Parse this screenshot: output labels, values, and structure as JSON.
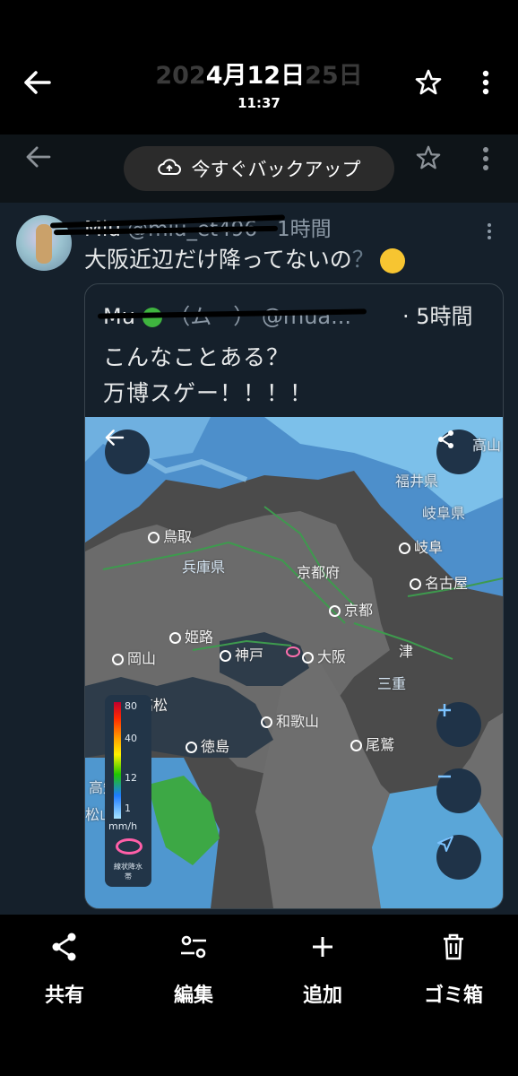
{
  "header": {
    "date_ghost_left": "202",
    "date": "4月12日",
    "date_ghost_right": "25日",
    "time": "11:37"
  },
  "backup": {
    "label": "今すぐバックアップ"
  },
  "tweet": {
    "name": "Miu",
    "handle": "@miu_et496",
    "time": "· 1時間",
    "text": "大阪近辺だけ降ってないの",
    "question_mark": "？"
  },
  "quote": {
    "name": "Mu",
    "handle": "@mua...",
    "time": "· 5時間",
    "line1": "こんなことある？",
    "line2": "万博スゲー！！！！"
  },
  "map": {
    "labels": {
      "tottori": "鳥取",
      "hyogo": "兵庫県",
      "kyoto_pref": "京都府",
      "kyoto": "京都",
      "fukui": "福井県",
      "gifu_pref": "岐阜県",
      "gifu": "岐阜",
      "nagoya": "名古屋",
      "okayama": "岡山",
      "himeji": "姫路",
      "kobe": "神戸",
      "osaka": "大阪",
      "tsu": "津",
      "takamatsu": "高松",
      "tokushima": "徳島",
      "wakayama": "和歌山",
      "owase": "尾鷲",
      "takayama": "高山",
      "kochi": "高知",
      "matsuyama": "松山",
      "mie": "三重",
      "unit": "mm/h",
      "ring_label": "線状降水帯"
    },
    "legend_values": [
      "80",
      "40",
      "12",
      "1"
    ]
  },
  "actions": {
    "share": "共有",
    "edit": "編集",
    "add": "追加",
    "trash": "ゴミ箱"
  },
  "colors": {
    "background": "#000000",
    "tweet_bg": "#15202b",
    "accent": "#1d9bf0",
    "rain_blue": "#3f7fb8"
  }
}
